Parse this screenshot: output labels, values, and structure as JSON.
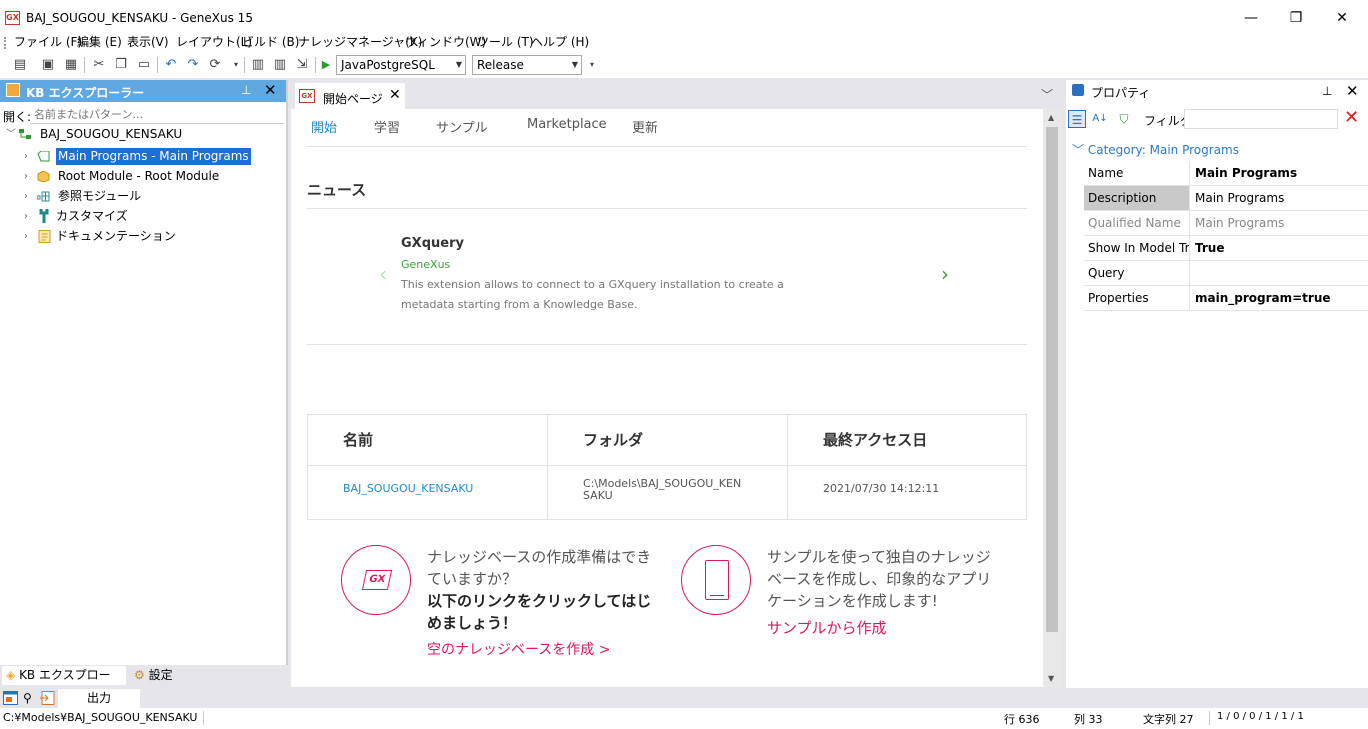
{
  "window": {
    "title": "BAJ_SOUGOU_KENSAKU - GeneXus 15",
    "logo_text": "GX"
  },
  "menu": [
    "ファイル (F)",
    "編集 (E)",
    "表示(V)",
    "レイアウト(L)",
    "ビルド (B)",
    "ナレッジマネージャ(K)",
    "ウィンドウ(W)",
    "ツール (T)",
    "ヘルプ (H)"
  ],
  "toolbar": {
    "environment": "JavaPostgreSQL",
    "configuration": "Release"
  },
  "kb_explorer": {
    "title": "KB エクスプローラー",
    "open_label": "開く:",
    "search_placeholder": "名前またはパターン...",
    "root": "BAJ_SOUGOU_KENSAKU",
    "items": [
      {
        "label": "Main Programs - Main Programs",
        "icon": "folder-tag-icon",
        "selected": true
      },
      {
        "label": "Root Module - Root Module",
        "icon": "package-icon"
      },
      {
        "label": "参照モジュール",
        "icon": "modules-icon"
      },
      {
        "label": "カスタマイズ",
        "icon": "wrench-icon"
      },
      {
        "label": "ドキュメンテーション",
        "icon": "document-icon"
      }
    ],
    "tabs": [
      "KB エクスプローラー",
      "設定"
    ]
  },
  "document": {
    "tab_title": "開始ページ",
    "tab_logo": "GX",
    "nav": [
      "開始",
      "学習",
      "サンプル",
      "Marketplace",
      "更新"
    ],
    "news_heading": "ニュース",
    "news_item": {
      "name": "GXquery",
      "author": "GeneXus",
      "description": "This extension allows to connect to a GXquery installation to create a metadata starting from a Knowledge Base."
    },
    "recent_table": {
      "headers": [
        "名前",
        "フォルダ",
        "最終アクセス日"
      ],
      "rows": [
        {
          "name": "BAJ_SOUGOU_KENSAKU",
          "folder": "C:\\Models\\BAJ_SOUGOU_KEN SAKU",
          "last_access": "2021/07/30 14:12:11"
        }
      ]
    },
    "promo_left": {
      "icon_text": "GX",
      "text": "ナレッジベースの作成準備はできていますか？",
      "bold": "以下のリンクをクリックしてはじめましょう！",
      "link": "空のナレッジベースを作成 >"
    },
    "promo_right": {
      "text": "サンプルを使って独自のナレッジベースを作成し、印象的なアプリケーションを作成します!",
      "link": "サンプルから作成"
    }
  },
  "properties": {
    "title": "プロパティ",
    "filter_label": "フィルタ",
    "category": "Category: Main Programs",
    "rows": [
      {
        "name": "Name",
        "value": "Main Programs",
        "style": "bold"
      },
      {
        "name": "Description",
        "value": "Main Programs",
        "style": "normal",
        "selected": true
      },
      {
        "name": "Qualified Name",
        "value": "Main Programs",
        "style": "grey"
      },
      {
        "name": "Show In Model Tree",
        "value": "True",
        "style": "bold"
      },
      {
        "name": "Query",
        "value": "",
        "style": "normal"
      },
      {
        "name": "Properties",
        "value": "main_program=true",
        "style": "bold"
      }
    ]
  },
  "output": {
    "tab_label": "出力"
  },
  "statusbar": {
    "path": "C:¥Models¥BAJ_SOUGOU_KENSAKU",
    "line": "行 636",
    "col": "列 33",
    "chars": "文字列 27",
    "counts": "1 / 0 / 0 / 1 / 1 / 1"
  }
}
